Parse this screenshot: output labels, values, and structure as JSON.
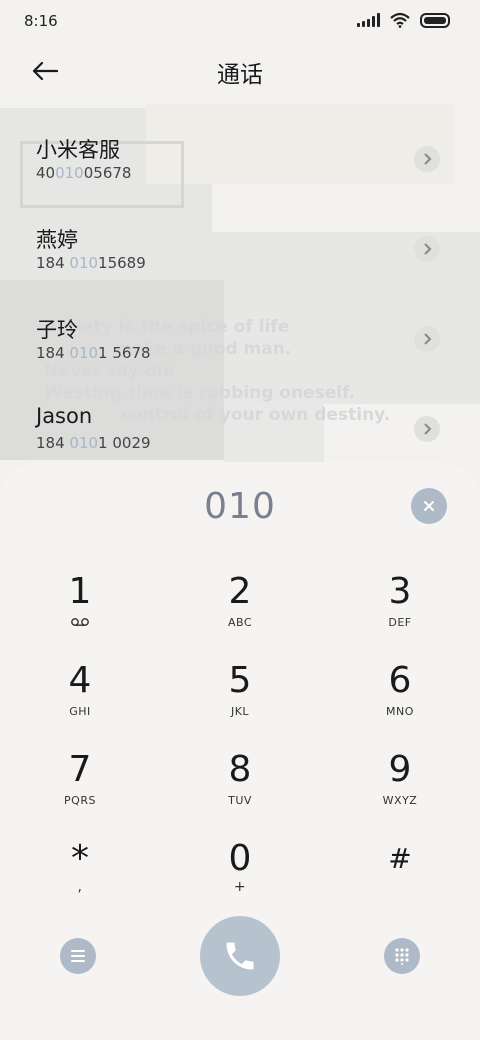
{
  "status": {
    "time": "8:16",
    "icons": [
      "signal-icon",
      "wifi-icon",
      "battery-icon"
    ]
  },
  "header": {
    "title": "通话",
    "back_icon": "back-arrow-icon"
  },
  "decor_text": [
    "Variety is the spice of life",
    "make a good man.",
    "Never say die",
    "Wasting time is robbing oneself.",
    "control of your own destiny."
  ],
  "contacts": [
    {
      "name": "小米客服",
      "num_pre": "40",
      "num_hl": "010",
      "num_post": "05678"
    },
    {
      "name": "燕婷",
      "num_pre": "184 ",
      "num_hl": "010",
      "num_post": "15689"
    },
    {
      "name": "子玲",
      "num_pre": "184 ",
      "num_hl": "010",
      "num_post": "1 5678"
    },
    {
      "name": "Jason",
      "num_pre": "184 ",
      "num_hl": "010",
      "num_post": "1 0029"
    }
  ],
  "dialer": {
    "input": "010",
    "keys": [
      {
        "digit": "1",
        "sub": ""
      },
      {
        "digit": "2",
        "sub": "ABC"
      },
      {
        "digit": "3",
        "sub": "DEF"
      },
      {
        "digit": "4",
        "sub": "GHI"
      },
      {
        "digit": "5",
        "sub": "JKL"
      },
      {
        "digit": "6",
        "sub": "MNO"
      },
      {
        "digit": "7",
        "sub": "PQRS"
      },
      {
        "digit": "8",
        "sub": "TUV"
      },
      {
        "digit": "9",
        "sub": "WXYZ"
      },
      {
        "digit": "*",
        "sub": ","
      },
      {
        "digit": "0",
        "sub": "+"
      },
      {
        "digit": "#",
        "sub": ""
      }
    ]
  },
  "colors": {
    "accent": "#aebac8",
    "call": "#b6c2ce",
    "highlight": "#a7b6c8",
    "background": "#f3f2f0"
  }
}
